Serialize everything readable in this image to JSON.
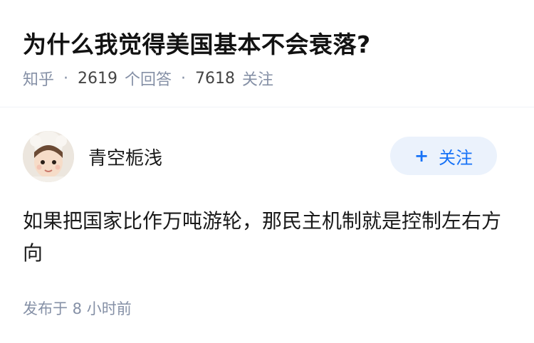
{
  "question": {
    "title": "为什么我觉得美国基本不会衰落?",
    "source": "知乎",
    "answer_count": "2619",
    "answer_label": "个回答",
    "follower_count": "7618",
    "follower_label": "关注"
  },
  "answer": {
    "author_name": "青空栀浅",
    "follow_plus": "+",
    "follow_label": "关注",
    "content": "如果把国家比作万吨游轮，那民主机制就是控制左右方向",
    "post_time": "发布于 8 小时前"
  },
  "colors": {
    "accent": "#1772f6",
    "follow_bg": "#ebf2fc",
    "meta_gray": "#8590a6"
  }
}
